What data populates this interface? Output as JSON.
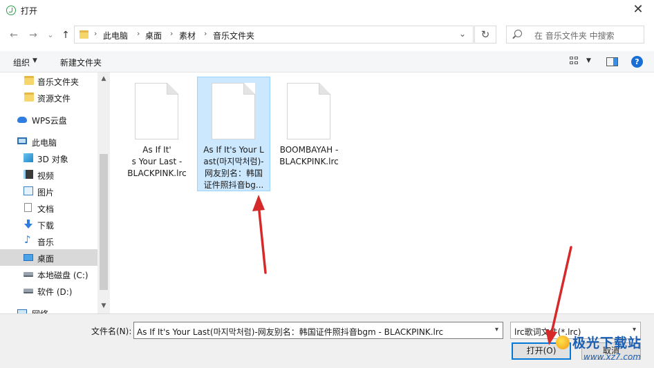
{
  "window": {
    "title": "打开",
    "close_label": "✕"
  },
  "nav": {
    "back": "←",
    "forward": "→",
    "recent": "⌄",
    "up": "↑"
  },
  "address": {
    "crumbs": [
      "此电脑",
      "桌面",
      "素材",
      "音乐文件夹"
    ],
    "separator": "›",
    "dropdown": "⌄",
    "refresh": "↻"
  },
  "search": {
    "placeholder": "在 音乐文件夹 中搜索"
  },
  "toolbar": {
    "organize": "组织",
    "organize_caret": "▼",
    "new_folder": "新建文件夹",
    "view_caret": "▼",
    "help": "?"
  },
  "sidebar": {
    "items": [
      {
        "label": "音乐文件夹",
        "icon": "folder-icon"
      },
      {
        "label": "资源文件",
        "icon": "folder-icon"
      },
      {
        "label": "WPS云盘",
        "icon": "cloud-icon"
      },
      {
        "label": "此电脑",
        "icon": "computer-icon"
      },
      {
        "label": "3D 对象",
        "icon": "cube-icon"
      },
      {
        "label": "视频",
        "icon": "video-icon"
      },
      {
        "label": "图片",
        "icon": "picture-icon"
      },
      {
        "label": "文档",
        "icon": "document-icon"
      },
      {
        "label": "下载",
        "icon": "download-icon"
      },
      {
        "label": "音乐",
        "icon": "music-icon"
      },
      {
        "label": "桌面",
        "icon": "desktop-icon",
        "selected": true
      },
      {
        "label": "本地磁盘 (C:)",
        "icon": "drive-icon"
      },
      {
        "label": "软件 (D:)",
        "icon": "drive-icon"
      },
      {
        "label": "网络",
        "icon": "network-icon"
      }
    ],
    "scroll_up": "▲",
    "scroll_down": "▼"
  },
  "files": [
    {
      "name": "As If It'\ns Your Last -\nBLACKPINK.lrc",
      "selected": false
    },
    {
      "name": "As If It's Your L\nast(마지막처럼)-\n网友别名：韩国\n证件照抖音bg...",
      "selected": true
    },
    {
      "name": "BOOMBAYAH -\nBLACKPINK.lrc",
      "selected": false
    }
  ],
  "bottom": {
    "filename_label": "文件名(N):",
    "filename_value": "As If It's Your Last(마지막처럼)-网友别名：韩国证件照抖音bgm - BLACKPINK.lrc",
    "filetype_value": "lrc歌词文件(*.lrc)",
    "caret": "▾",
    "open_label": "打开(O)",
    "cancel_label": "取消"
  },
  "watermark": {
    "title": "极光下载站",
    "url": "www.xz7.com"
  },
  "colors": {
    "accent": "#0078d7",
    "selection": "#cce8ff",
    "arrow": "#d62a2a"
  }
}
